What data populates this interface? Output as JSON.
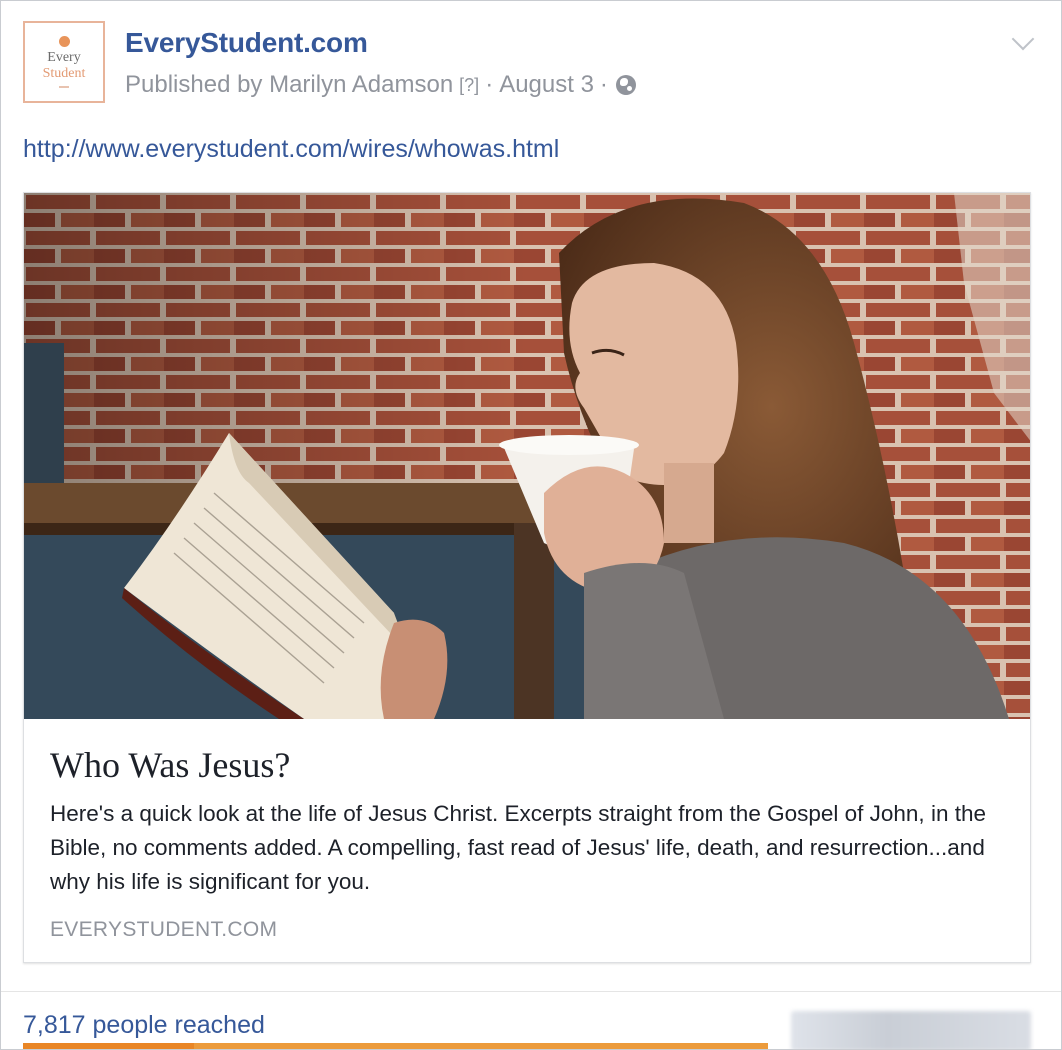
{
  "page": {
    "name": "EveryStudent.com",
    "logo_text_line1": "Every",
    "logo_text_line2": "Student"
  },
  "post": {
    "published_by": "Published by Marilyn Adamson",
    "help_marker": "[?]",
    "separator": "·",
    "date": "August 3",
    "audience_icon": "globe-icon",
    "menu_icon": "chevron-down-icon",
    "link_url": "http://www.everystudent.com/wires/whowas.html"
  },
  "attachment": {
    "image_icon": "photo-woman-reading-bible",
    "title": "Who Was Jesus?",
    "description": "Here's a quick look at the life of Jesus Christ. Excerpts straight from the Gospel of John, in the Bible, no comments added. A compelling, fast read of Jesus' life, death, and resurrection...and why his life is significant for you.",
    "domain": "EVERYSTUDENT.COM"
  },
  "insights": {
    "reach_text": "7,817 people reached",
    "reach_progress": 0.23
  },
  "colors": {
    "link": "#365899",
    "meta": "#90949c",
    "reach_bar": "#ec9b3b"
  }
}
